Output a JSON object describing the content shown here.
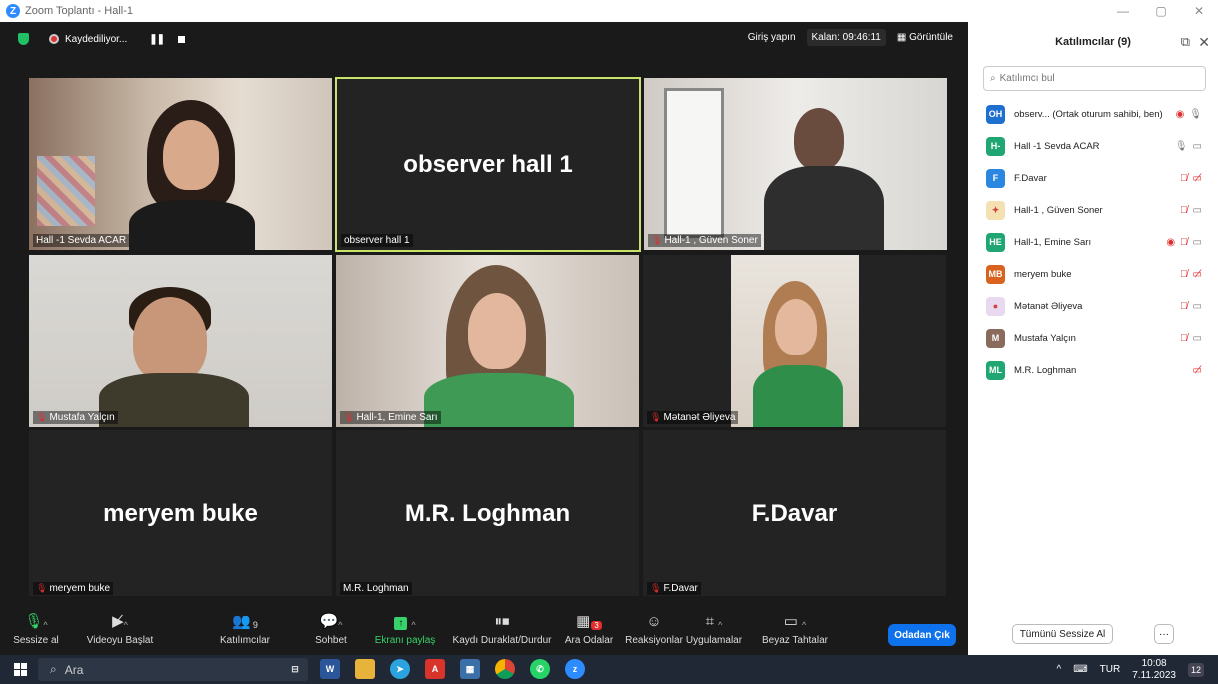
{
  "window": {
    "title": "Zoom Toplantı - Hall-1",
    "app_logo": "Z"
  },
  "topbar": {
    "recording": "Kaydediliyor...",
    "signin": "Giriş yapın",
    "timer": "Kalan: 09:46:11",
    "view": "Görüntüle"
  },
  "tiles": [
    {
      "name": "Hall -1 Sevda ACAR"
    },
    {
      "name": "observer hall 1",
      "big": "observer hall 1"
    },
    {
      "name": "Hall-1 , Güven Soner"
    },
    {
      "name": "Mustafa Yalçın"
    },
    {
      "name": "Hall-1, Emine Sarı"
    },
    {
      "name": "Mətanət Əliyeva"
    },
    {
      "name": "meryem buke",
      "big": "meryem buke"
    },
    {
      "name": "M.R. Loghman",
      "big": "M.R. Loghman"
    },
    {
      "name": "F.Davar",
      "big": "F.Davar"
    }
  ],
  "toolbar": {
    "mute": "Sessize al",
    "video": "Videoyu Başlat",
    "participants": "Katılımcılar",
    "participants_count": "9",
    "chat": "Sohbet",
    "share": "Ekranı paylaş",
    "rec_pause": "Kaydı Duraklat/Durdur",
    "breakout": "Ara Odalar",
    "breakout_badge": "3",
    "reactions": "Reaksiyonlar",
    "apps": "Uygulamalar",
    "whiteboard": "Beyaz Tahtalar",
    "leave": "Odadan Çık"
  },
  "panel": {
    "title": "Katılımcılar (9)",
    "search_placeholder": "Katılımcı bul",
    "participants": [
      {
        "initials": "OH",
        "name": "observ... (Ortak oturum sahibi, ben)",
        "color": "#1f6fd0"
      },
      {
        "initials": "H-",
        "name": "Hall -1 Sevda ACAR",
        "color": "#1fa672"
      },
      {
        "initials": "F",
        "name": "F.Davar",
        "color": "#2b86e0"
      },
      {
        "initials": "",
        "name": "Hall-1 , Güven Soner",
        "color": "#f4e0b0"
      },
      {
        "initials": "HE",
        "name": "Hall-1, Emine Sarı",
        "color": "#1fa672"
      },
      {
        "initials": "MB",
        "name": "meryem buke",
        "color": "#d8621e"
      },
      {
        "initials": "",
        "name": "Mətanət Əliyeva",
        "color": "#e8d8f0"
      },
      {
        "initials": "M",
        "name": "Mustafa Yalçın",
        "color": "#8a6a5a"
      },
      {
        "initials": "ML",
        "name": "M.R. Loghman",
        "color": "#1fa672"
      }
    ],
    "mute_all": "Tümünü Sessize Al",
    "more": "···"
  },
  "taskbar": {
    "search": "Ara",
    "lang": "TUR",
    "time": "10:08",
    "date": "7.11.2023",
    "notif": "12"
  }
}
